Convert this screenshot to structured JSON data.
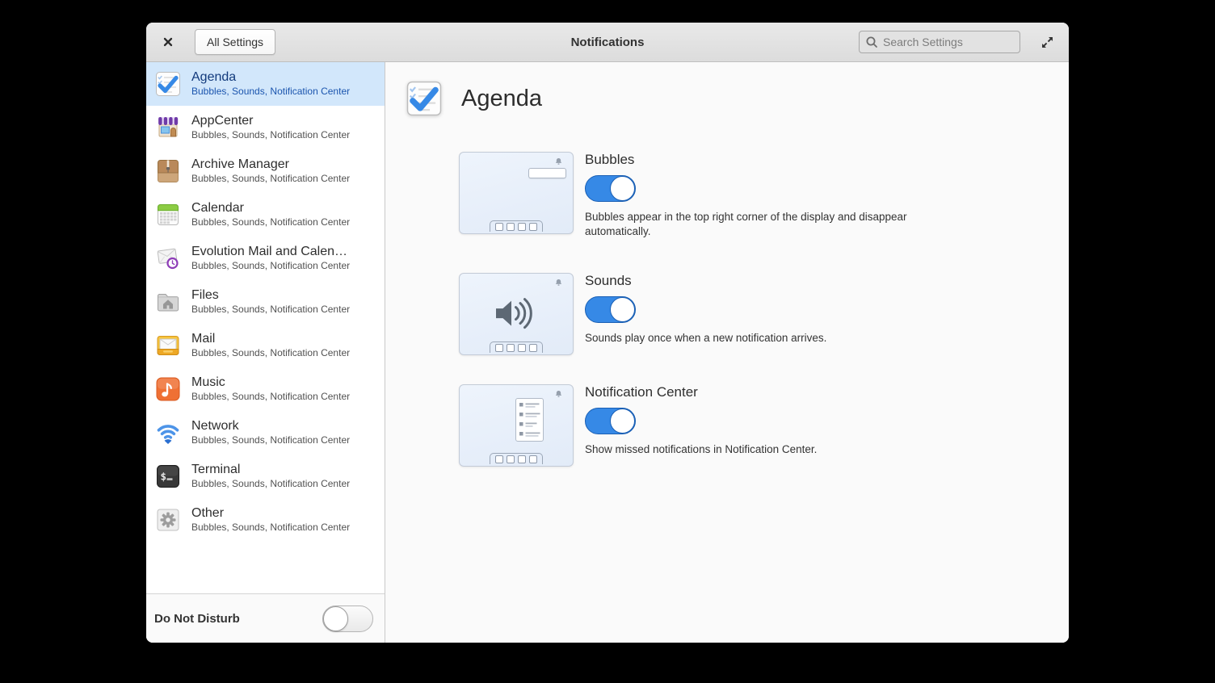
{
  "header": {
    "all_settings_label": "All Settings",
    "title": "Notifications",
    "search_placeholder": "Search Settings",
    "search_value": ""
  },
  "sidebar": {
    "items": [
      {
        "name": "Agenda",
        "subtitle": "Bubbles, Sounds, Notification Center",
        "icon": "agenda",
        "selected": true
      },
      {
        "name": "AppCenter",
        "subtitle": "Bubbles, Sounds, Notification Center",
        "icon": "appcenter",
        "selected": false
      },
      {
        "name": "Archive Manager",
        "subtitle": "Bubbles, Sounds, Notification Center",
        "icon": "archive",
        "selected": false
      },
      {
        "name": "Calendar",
        "subtitle": "Bubbles, Sounds, Notification Center",
        "icon": "calendar",
        "selected": false
      },
      {
        "name": "Evolution Mail and Calen…",
        "subtitle": "Bubbles, Sounds, Notification Center",
        "icon": "evolution",
        "selected": false
      },
      {
        "name": "Files",
        "subtitle": "Bubbles, Sounds, Notification Center",
        "icon": "files",
        "selected": false
      },
      {
        "name": "Mail",
        "subtitle": "Bubbles, Sounds, Notification Center",
        "icon": "mail",
        "selected": false
      },
      {
        "name": "Music",
        "subtitle": "Bubbles, Sounds, Notification Center",
        "icon": "music",
        "selected": false
      },
      {
        "name": "Network",
        "subtitle": "Bubbles, Sounds, Notification Center",
        "icon": "network",
        "selected": false
      },
      {
        "name": "Terminal",
        "subtitle": "Bubbles, Sounds, Notification Center",
        "icon": "terminal",
        "selected": false
      },
      {
        "name": "Other",
        "subtitle": "Bubbles, Sounds, Notification Center",
        "icon": "other",
        "selected": false
      }
    ],
    "do_not_disturb": {
      "label": "Do Not Disturb",
      "enabled": false
    }
  },
  "main": {
    "app_title": "Agenda",
    "app_icon": "agenda",
    "settings": [
      {
        "label": "Bubbles",
        "enabled": true,
        "tile": "bubbles",
        "description": "Bubbles appear in the top right corner of the display and disappear automatically."
      },
      {
        "label": "Sounds",
        "enabled": true,
        "tile": "sounds",
        "description": "Sounds play once when a new notification arrives."
      },
      {
        "label": "Notification Center",
        "enabled": true,
        "tile": "notification-center",
        "description": "Show missed notifications in Notification Center."
      }
    ]
  },
  "colors": {
    "accent": "#3689e6",
    "selected_row_bg": "#d2e7fb",
    "selected_row_text": "#123a7c",
    "window_bg": "#fafafa"
  }
}
